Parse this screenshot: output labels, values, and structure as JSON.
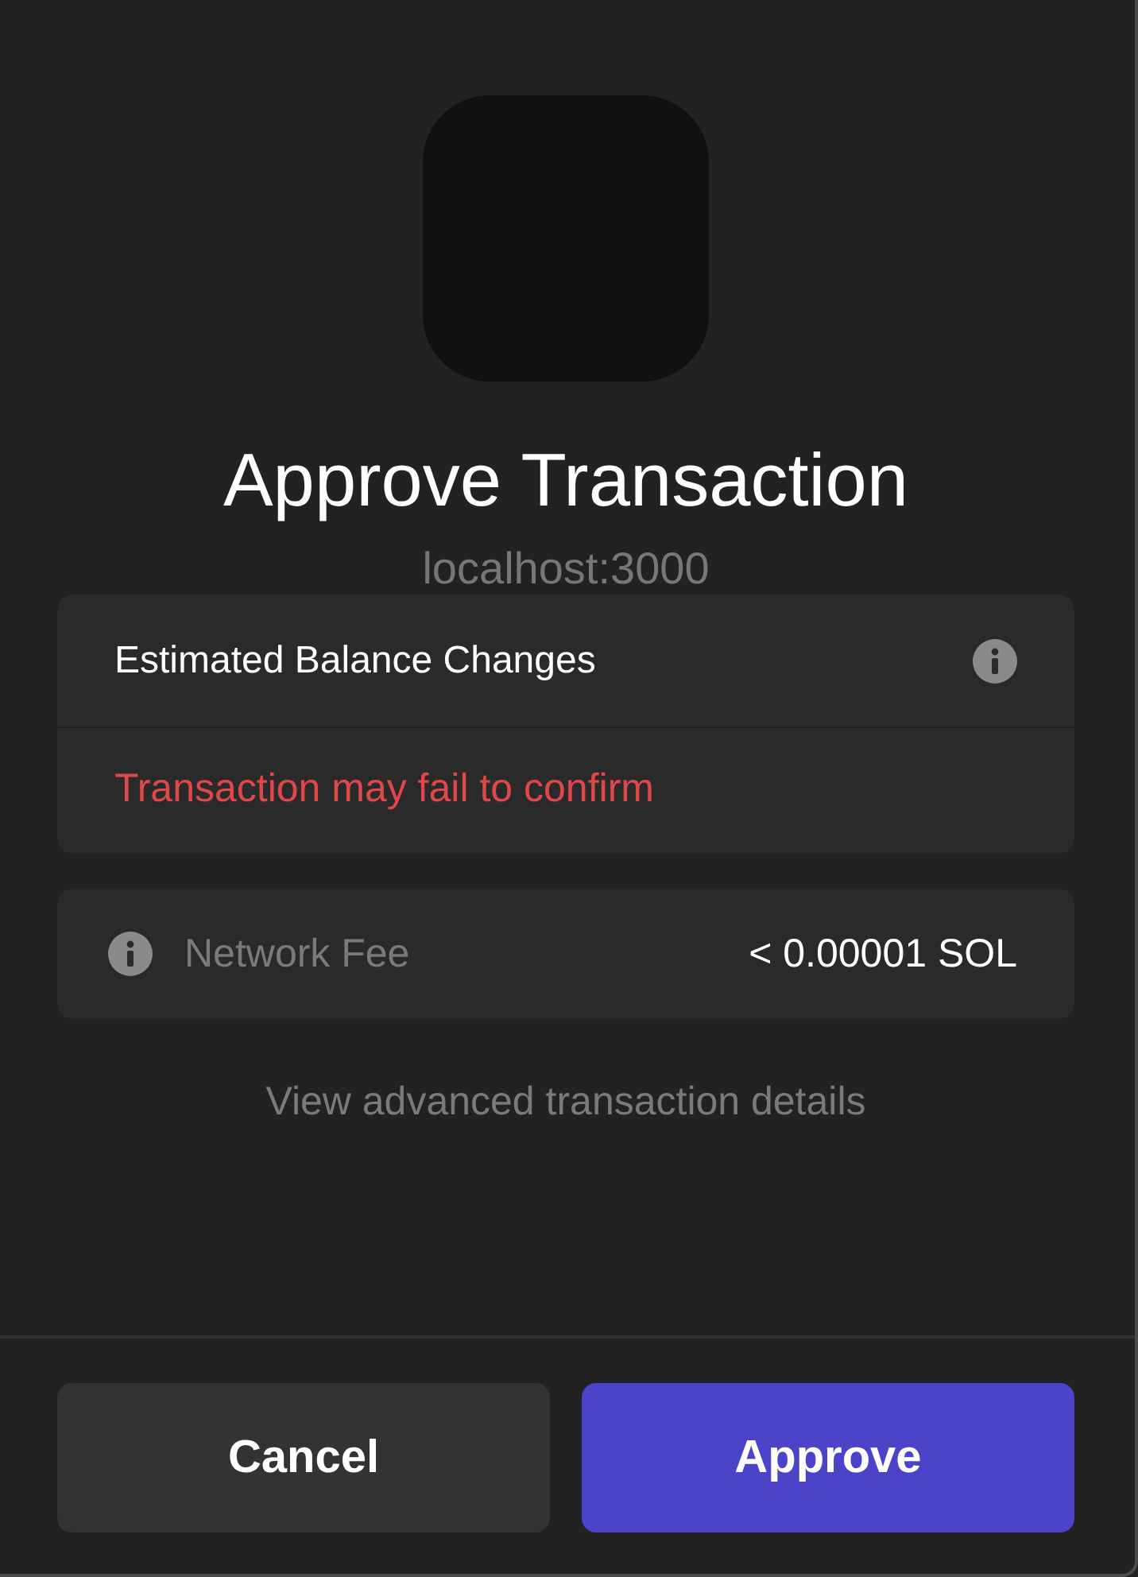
{
  "title": "Approve Transaction",
  "origin": "localhost:3000",
  "balance_card": {
    "heading": "Estimated Balance Changes",
    "warning": "Transaction may fail to confirm"
  },
  "fee": {
    "label": "Network Fee",
    "value": "< 0.00001 SOL"
  },
  "advanced_link": "View advanced transaction details",
  "buttons": [
    {
      "label": "Cancel",
      "kind": "secondary"
    },
    {
      "label": "Approve",
      "kind": "primary"
    }
  ]
}
